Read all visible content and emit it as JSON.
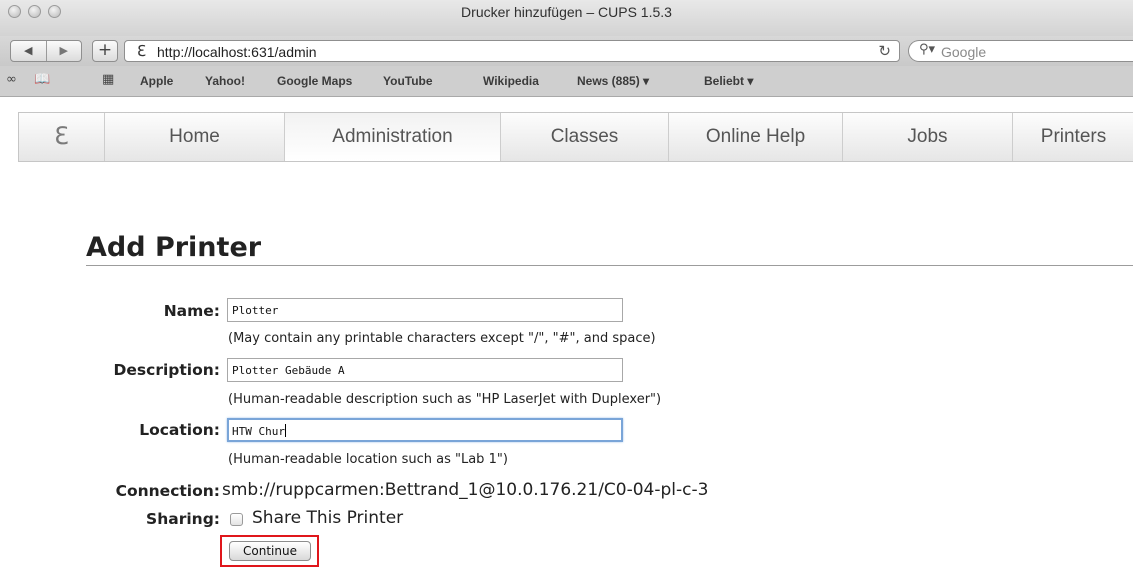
{
  "window": {
    "title": "Drucker hinzufügen – CUPS 1.5.3"
  },
  "toolbar": {
    "back_icon": "back-arrow-icon",
    "forward_icon": "forward-arrow-icon",
    "back_glyph": "◀",
    "forward_glyph": "▶",
    "add_glyph": "+",
    "url": "http://localhost:631/admin",
    "url_icon": "cups-favicon-icon",
    "reload_icon": "reload-icon",
    "search_placeholder": "Google"
  },
  "bookmarks": {
    "items": [
      {
        "label": "Apple"
      },
      {
        "label": "Yahoo!"
      },
      {
        "label": "Google Maps"
      },
      {
        "label": "YouTube"
      },
      {
        "label": "Wikipedia"
      },
      {
        "label": "News (885) ▾"
      },
      {
        "label": "Beliebt ▾"
      }
    ]
  },
  "nav": {
    "tabs": [
      {
        "label": "Home"
      },
      {
        "label": "Administration",
        "active": true
      },
      {
        "label": "Classes"
      },
      {
        "label": "Online Help"
      },
      {
        "label": "Jobs"
      },
      {
        "label": "Printers"
      }
    ]
  },
  "page": {
    "title": "Add Printer"
  },
  "form": {
    "name": {
      "label": "Name:",
      "value": "Plotter",
      "hint": "(May contain any printable characters except \"/\", \"#\", and space)"
    },
    "description": {
      "label": "Description:",
      "value": "Plotter Gebäude A",
      "hint": "(Human-readable description such as \"HP LaserJet with Duplexer\")"
    },
    "location": {
      "label": "Location:",
      "value": "HTW Chur",
      "hint": "(Human-readable location such as \"Lab 1\")"
    },
    "connection": {
      "label": "Connection:",
      "value": "smb://ruppcarmen:Bettrand_1@10.0.176.21/C0-04-pl-c-3"
    },
    "sharing": {
      "label": "Sharing:",
      "checkbox_label": "Share This Printer",
      "checked": false
    },
    "continue_label": "Continue"
  },
  "colors": {
    "highlight": "#e0161b",
    "focus_ring": "#7aa5d8"
  }
}
